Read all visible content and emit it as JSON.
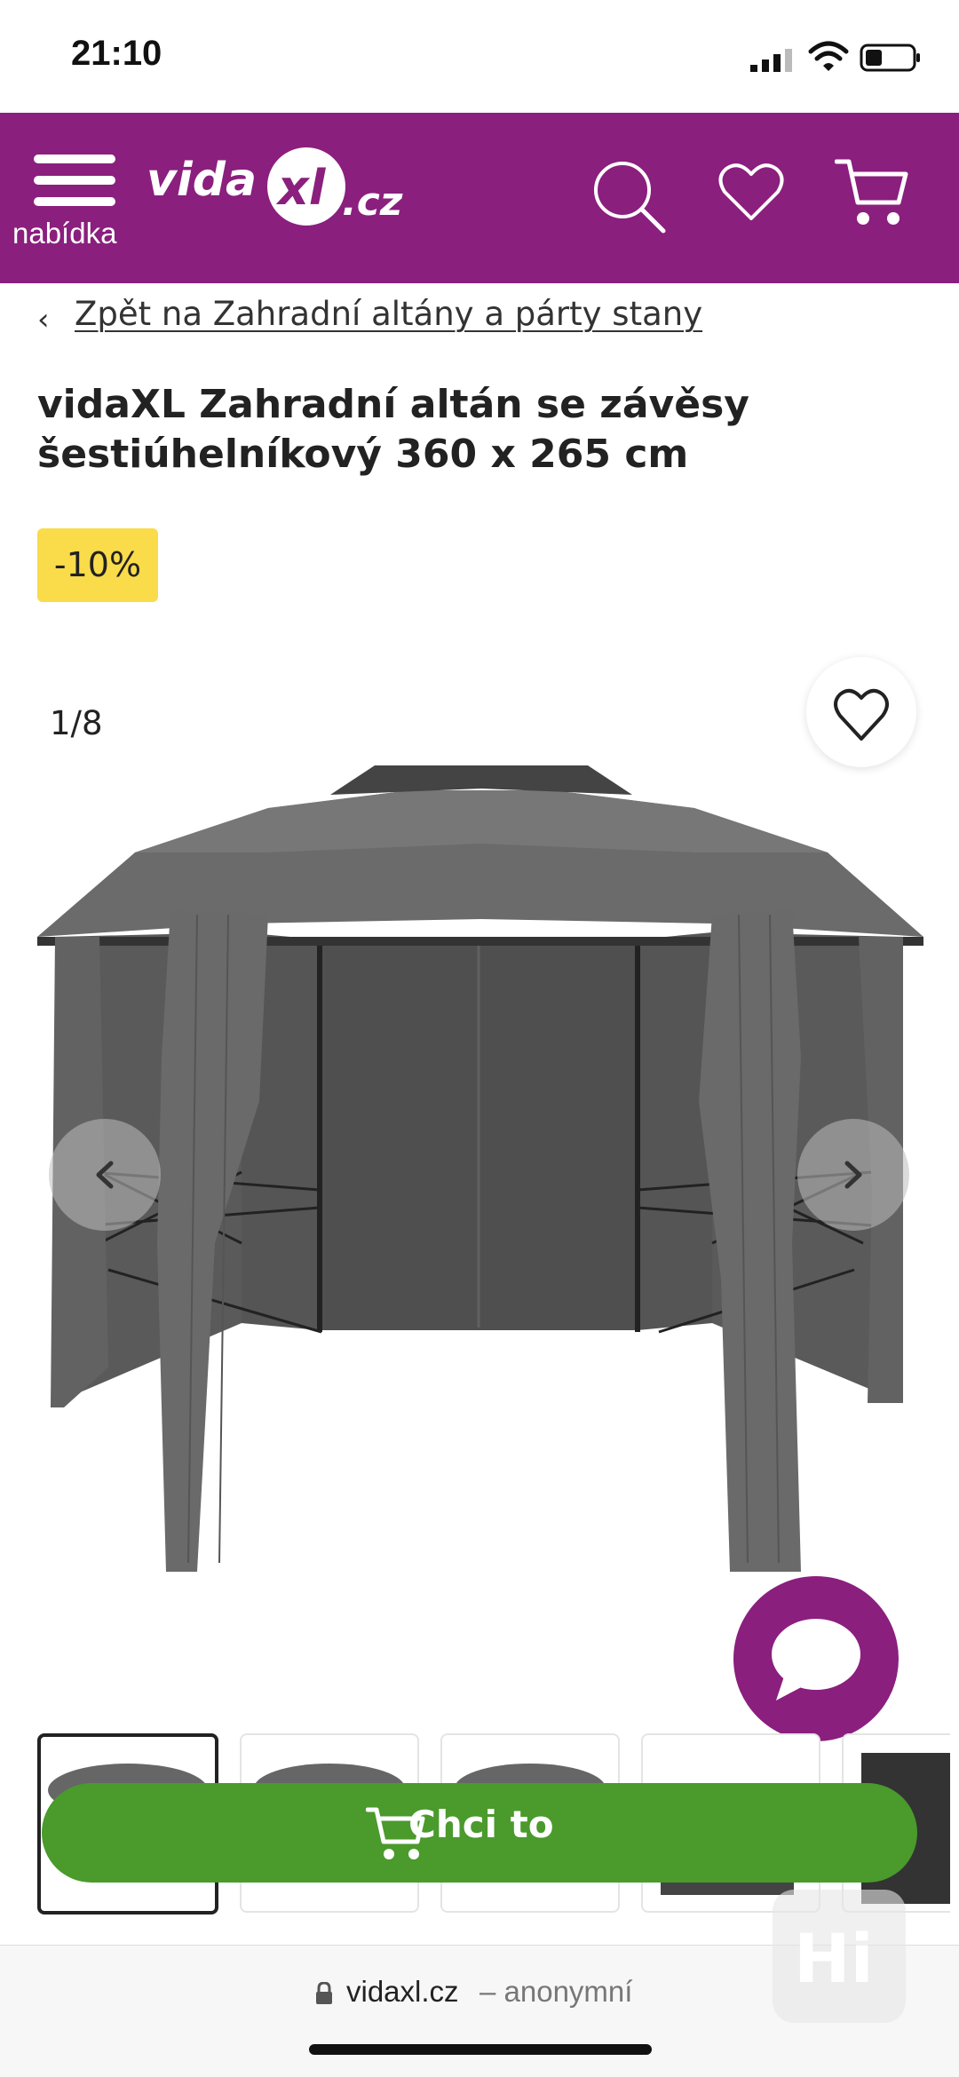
{
  "status_bar": {
    "time": "21:10"
  },
  "header": {
    "menu_label": "nabídka",
    "logo_text": "vidaxl.cz",
    "background_color": "#8a1f7e",
    "icons": [
      "menu-icon",
      "search-icon",
      "heart-icon",
      "cart-icon"
    ]
  },
  "breadcrumb": {
    "back_label": "Zpět na Zahradní altány a párty stany"
  },
  "product": {
    "title_line1": "vidaXL Zahradní altán se závěsy",
    "title_line2": "šestiúhelníkový 360 x 265 cm",
    "discount": "-10%",
    "discount_color": "#fadb4a"
  },
  "gallery": {
    "counter": "1/8",
    "thumbnail_count": 5,
    "icons": [
      "heart-icon",
      "chevron-left-icon",
      "chevron-right-icon",
      "chat-icon"
    ]
  },
  "cta": {
    "label": "Chci to",
    "color": "#4a9a2c"
  },
  "browser": {
    "url": "vidaxl.cz",
    "mode": "– anonymní"
  }
}
